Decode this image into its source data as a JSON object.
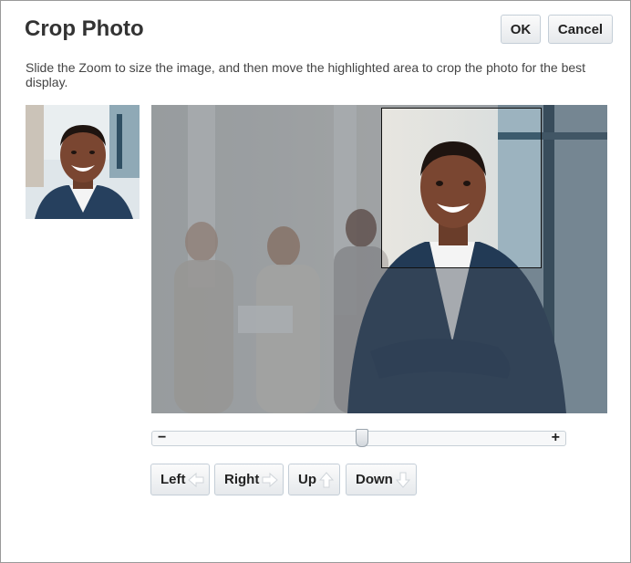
{
  "dialog": {
    "title": "Crop Photo",
    "ok_label": "OK",
    "cancel_label": "Cancel",
    "instructions": "Slide the Zoom to size the image, and then move the highlighted area to crop the photo for the best display."
  },
  "zoom": {
    "minus": "−",
    "plus": "+",
    "level": 0.5
  },
  "nav": {
    "left": "Left",
    "right": "Right",
    "up": "Up",
    "down": "Down"
  },
  "icons": {
    "left": "arrow-left-icon",
    "right": "arrow-right-icon",
    "up": "arrow-up-icon",
    "down": "arrow-down-icon"
  },
  "colors": {
    "border": "#9a9a9a",
    "button_border": "#c4ced7",
    "text": "#333333"
  }
}
